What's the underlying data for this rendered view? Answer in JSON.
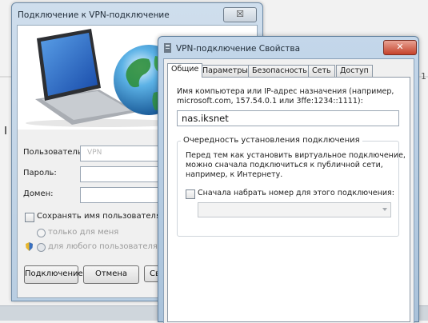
{
  "connect_dialog": {
    "title": "Подключение к VPN-подключение",
    "close_label": "☒",
    "user_label": "Пользователь:",
    "user_value": "VPN",
    "password_label": "Пароль:",
    "domain_label": "Домен:",
    "save_checkbox_label": "Сохранять имя пользователя и па",
    "radio_only_me": "только для меня",
    "radio_any_user": "для любого пользователя",
    "connect_button": "Подключение",
    "cancel_button": "Отмена",
    "third_button": "Сво"
  },
  "properties_dialog": {
    "title": "VPN-подключение Свойства",
    "close_label": "✕",
    "tabs": [
      "Общие",
      "Параметры",
      "Безопасность",
      "Сеть",
      "Доступ"
    ],
    "active_tab": "Общие",
    "host_label_line1": "Имя компьютера или IP-адрес назначения (например,",
    "host_label_line2": "microsoft.com, 157.54.0.1 или 3ffe:1234::1111):",
    "host_value": "nas.iksnet",
    "group_title": "Очередность установления подключения",
    "group_text_line1": "Перед тем как установить виртуальное подключение,",
    "group_text_line2": "можно сначала подключиться к публичной сети,",
    "group_text_line3": "например, к Интернету.",
    "dial_first_label": "Сначала набрать номер для этого подключения:",
    "dial_first_value": ""
  },
  "desktop": {
    "edge_mark": "1"
  },
  "colors": {
    "title_bar": "#c4d7ea",
    "close_active": "#c5422b",
    "panel_bg": "#f0f0f0"
  }
}
